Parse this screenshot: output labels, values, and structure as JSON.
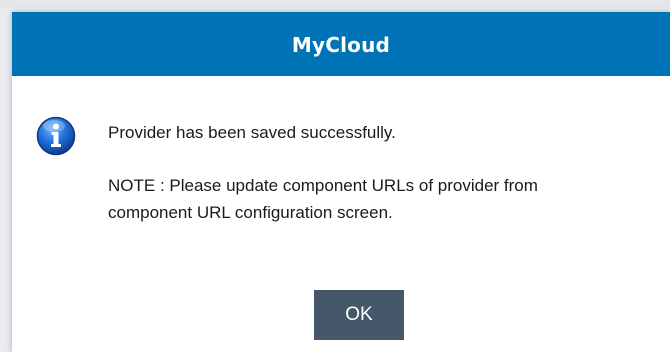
{
  "dialog": {
    "title": "MyCloud",
    "message": "Provider has been saved successfully.",
    "note": "NOTE : Please update component URLs of provider from component URL configuration screen.",
    "ok_label": "OK",
    "icon": "info-icon"
  },
  "colors": {
    "titlebar": "#0073b7",
    "button": "#46576a",
    "icon_blue": "#1565c0"
  }
}
